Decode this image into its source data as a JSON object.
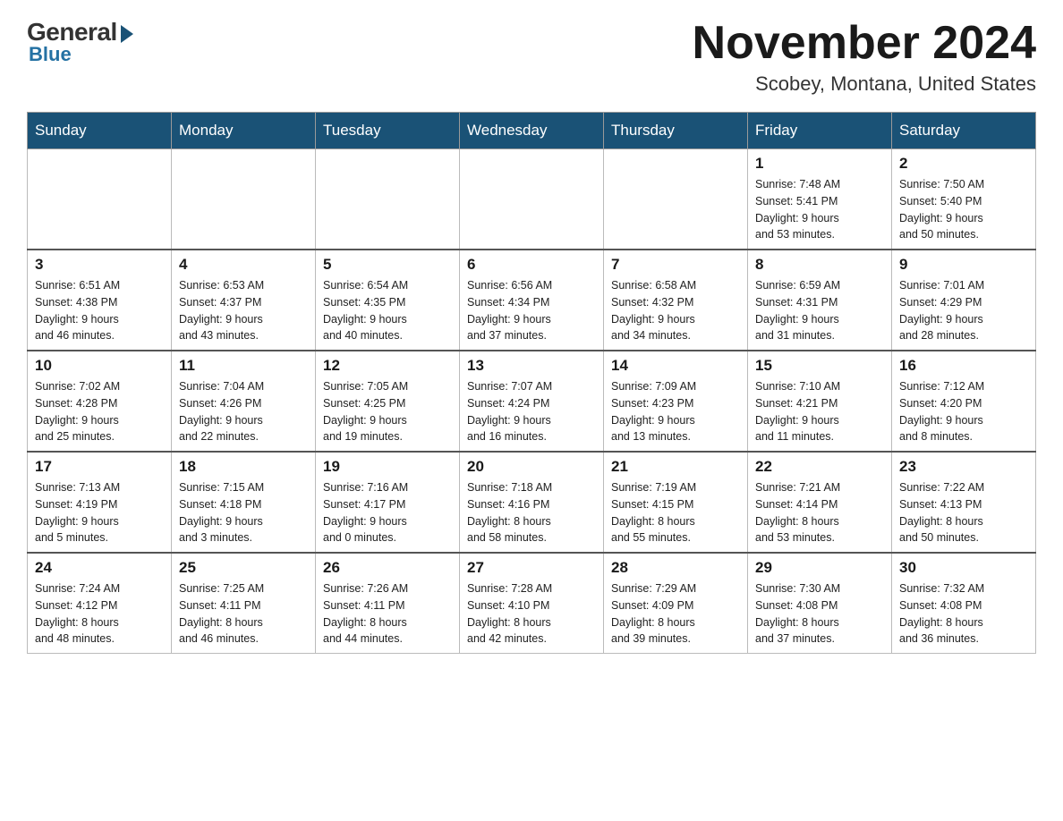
{
  "logo": {
    "general": "General",
    "blue": "Blue"
  },
  "header": {
    "title": "November 2024",
    "location": "Scobey, Montana, United States"
  },
  "weekdays": [
    "Sunday",
    "Monday",
    "Tuesday",
    "Wednesday",
    "Thursday",
    "Friday",
    "Saturday"
  ],
  "weeks": [
    [
      {
        "day": "",
        "info": ""
      },
      {
        "day": "",
        "info": ""
      },
      {
        "day": "",
        "info": ""
      },
      {
        "day": "",
        "info": ""
      },
      {
        "day": "",
        "info": ""
      },
      {
        "day": "1",
        "info": "Sunrise: 7:48 AM\nSunset: 5:41 PM\nDaylight: 9 hours\nand 53 minutes."
      },
      {
        "day": "2",
        "info": "Sunrise: 7:50 AM\nSunset: 5:40 PM\nDaylight: 9 hours\nand 50 minutes."
      }
    ],
    [
      {
        "day": "3",
        "info": "Sunrise: 6:51 AM\nSunset: 4:38 PM\nDaylight: 9 hours\nand 46 minutes."
      },
      {
        "day": "4",
        "info": "Sunrise: 6:53 AM\nSunset: 4:37 PM\nDaylight: 9 hours\nand 43 minutes."
      },
      {
        "day": "5",
        "info": "Sunrise: 6:54 AM\nSunset: 4:35 PM\nDaylight: 9 hours\nand 40 minutes."
      },
      {
        "day": "6",
        "info": "Sunrise: 6:56 AM\nSunset: 4:34 PM\nDaylight: 9 hours\nand 37 minutes."
      },
      {
        "day": "7",
        "info": "Sunrise: 6:58 AM\nSunset: 4:32 PM\nDaylight: 9 hours\nand 34 minutes."
      },
      {
        "day": "8",
        "info": "Sunrise: 6:59 AM\nSunset: 4:31 PM\nDaylight: 9 hours\nand 31 minutes."
      },
      {
        "day": "9",
        "info": "Sunrise: 7:01 AM\nSunset: 4:29 PM\nDaylight: 9 hours\nand 28 minutes."
      }
    ],
    [
      {
        "day": "10",
        "info": "Sunrise: 7:02 AM\nSunset: 4:28 PM\nDaylight: 9 hours\nand 25 minutes."
      },
      {
        "day": "11",
        "info": "Sunrise: 7:04 AM\nSunset: 4:26 PM\nDaylight: 9 hours\nand 22 minutes."
      },
      {
        "day": "12",
        "info": "Sunrise: 7:05 AM\nSunset: 4:25 PM\nDaylight: 9 hours\nand 19 minutes."
      },
      {
        "day": "13",
        "info": "Sunrise: 7:07 AM\nSunset: 4:24 PM\nDaylight: 9 hours\nand 16 minutes."
      },
      {
        "day": "14",
        "info": "Sunrise: 7:09 AM\nSunset: 4:23 PM\nDaylight: 9 hours\nand 13 minutes."
      },
      {
        "day": "15",
        "info": "Sunrise: 7:10 AM\nSunset: 4:21 PM\nDaylight: 9 hours\nand 11 minutes."
      },
      {
        "day": "16",
        "info": "Sunrise: 7:12 AM\nSunset: 4:20 PM\nDaylight: 9 hours\nand 8 minutes."
      }
    ],
    [
      {
        "day": "17",
        "info": "Sunrise: 7:13 AM\nSunset: 4:19 PM\nDaylight: 9 hours\nand 5 minutes."
      },
      {
        "day": "18",
        "info": "Sunrise: 7:15 AM\nSunset: 4:18 PM\nDaylight: 9 hours\nand 3 minutes."
      },
      {
        "day": "19",
        "info": "Sunrise: 7:16 AM\nSunset: 4:17 PM\nDaylight: 9 hours\nand 0 minutes."
      },
      {
        "day": "20",
        "info": "Sunrise: 7:18 AM\nSunset: 4:16 PM\nDaylight: 8 hours\nand 58 minutes."
      },
      {
        "day": "21",
        "info": "Sunrise: 7:19 AM\nSunset: 4:15 PM\nDaylight: 8 hours\nand 55 minutes."
      },
      {
        "day": "22",
        "info": "Sunrise: 7:21 AM\nSunset: 4:14 PM\nDaylight: 8 hours\nand 53 minutes."
      },
      {
        "day": "23",
        "info": "Sunrise: 7:22 AM\nSunset: 4:13 PM\nDaylight: 8 hours\nand 50 minutes."
      }
    ],
    [
      {
        "day": "24",
        "info": "Sunrise: 7:24 AM\nSunset: 4:12 PM\nDaylight: 8 hours\nand 48 minutes."
      },
      {
        "day": "25",
        "info": "Sunrise: 7:25 AM\nSunset: 4:11 PM\nDaylight: 8 hours\nand 46 minutes."
      },
      {
        "day": "26",
        "info": "Sunrise: 7:26 AM\nSunset: 4:11 PM\nDaylight: 8 hours\nand 44 minutes."
      },
      {
        "day": "27",
        "info": "Sunrise: 7:28 AM\nSunset: 4:10 PM\nDaylight: 8 hours\nand 42 minutes."
      },
      {
        "day": "28",
        "info": "Sunrise: 7:29 AM\nSunset: 4:09 PM\nDaylight: 8 hours\nand 39 minutes."
      },
      {
        "day": "29",
        "info": "Sunrise: 7:30 AM\nSunset: 4:08 PM\nDaylight: 8 hours\nand 37 minutes."
      },
      {
        "day": "30",
        "info": "Sunrise: 7:32 AM\nSunset: 4:08 PM\nDaylight: 8 hours\nand 36 minutes."
      }
    ]
  ]
}
